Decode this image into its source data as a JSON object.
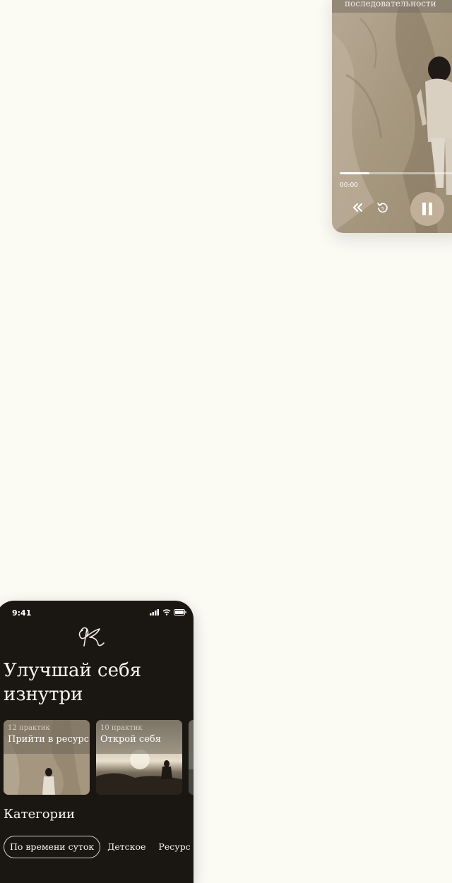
{
  "player": {
    "subtitle": "последовательности",
    "progress_fraction": 0.22,
    "time": "00:00"
  },
  "phone": {
    "status_time": "9:41",
    "headline": "Улучшай себя изнутри",
    "collections": [
      {
        "count": "12 практик",
        "name": "Прийти в ресурс"
      },
      {
        "count": "10 практик",
        "name": "Открой себя"
      },
      {
        "count": "",
        "name": ""
      }
    ],
    "categories_title": "Категории",
    "chips": [
      "По времени суток",
      "Детское",
      "Ресурс"
    ]
  },
  "colors": {
    "page_bg": "#fbfbf4",
    "phone_bg": "#1a1713",
    "pause_button": "#c4b29c"
  },
  "icons": [
    "rewind-icon",
    "replay-5-icon",
    "pause-icon",
    "signal-icon",
    "wifi-icon",
    "battery-icon",
    "logo-monogram"
  ]
}
